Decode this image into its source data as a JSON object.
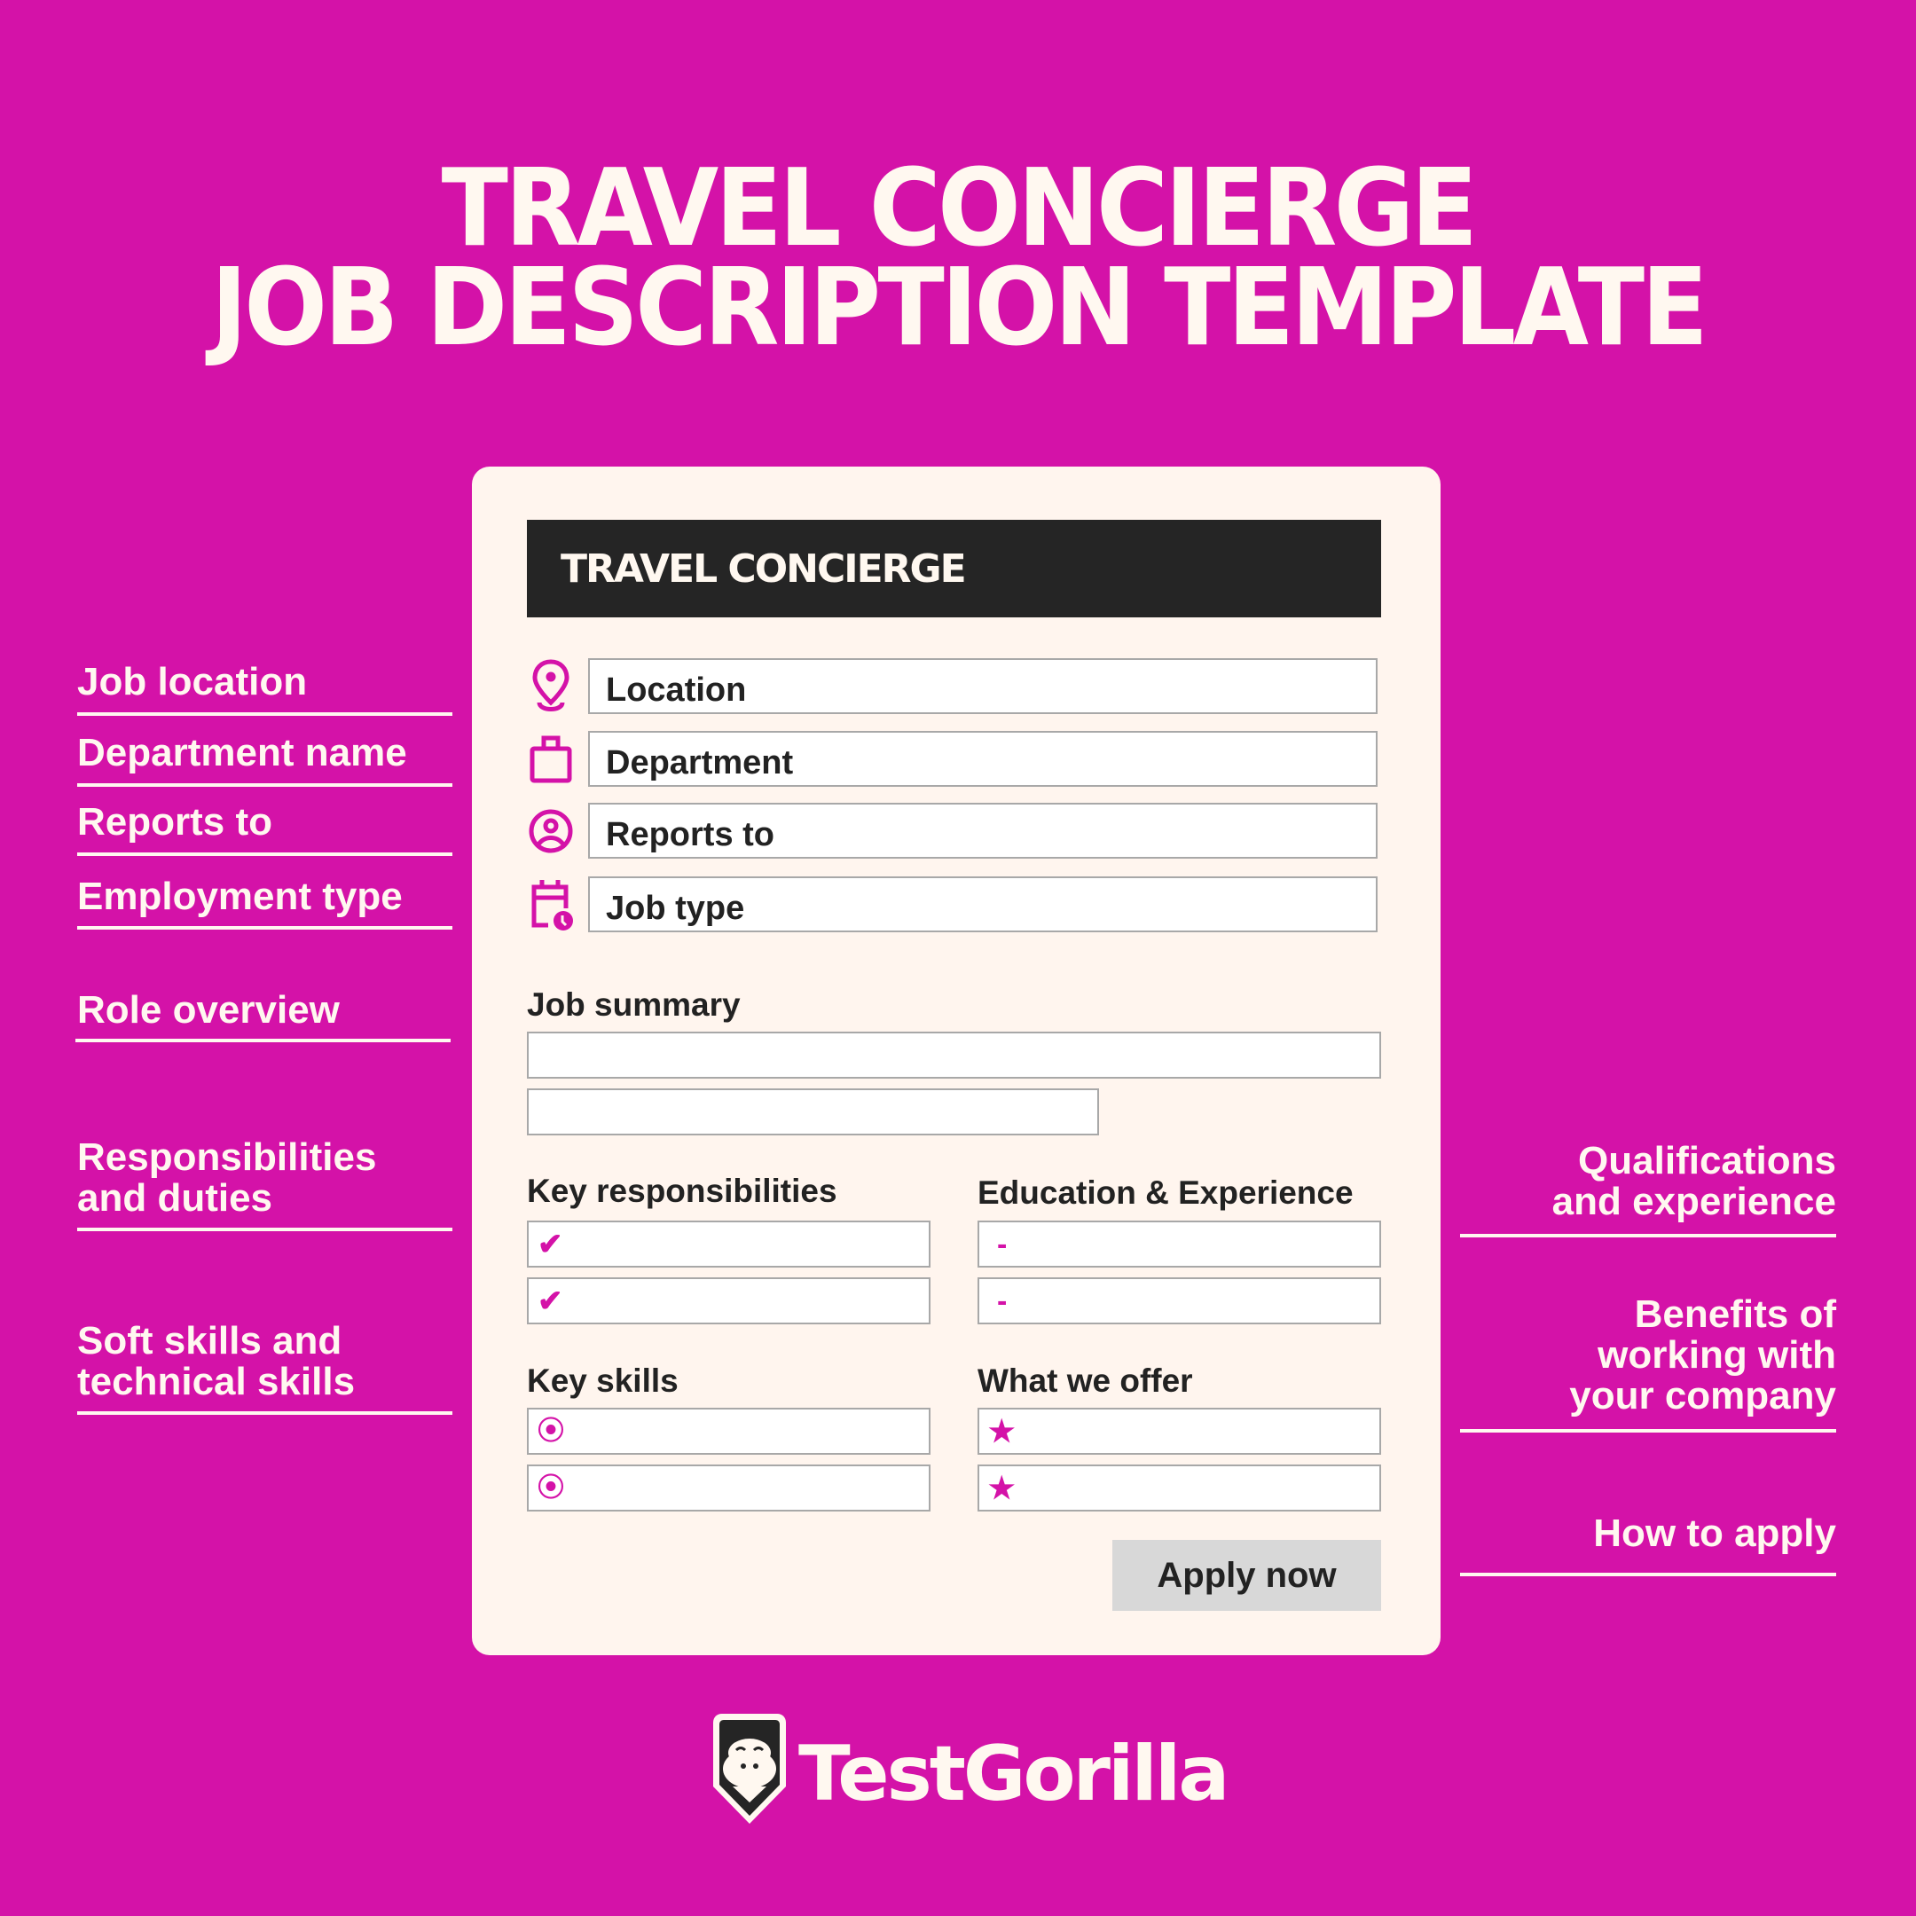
{
  "title": {
    "line1": "TRAVEL CONCIERGE",
    "line2": "JOB DESCRIPTION TEMPLATE"
  },
  "left_labels": [
    {
      "text": "Job location"
    },
    {
      "text": "Department name"
    },
    {
      "text": "Reports to"
    },
    {
      "text": "Employment type"
    },
    {
      "text": "Role overview"
    },
    {
      "text": "Responsibilities and duties"
    },
    {
      "text": "Soft skills and technical skills"
    }
  ],
  "right_labels": [
    {
      "text": "Qualifications and experience"
    },
    {
      "text": "Benefits of working with your company"
    },
    {
      "text": "How to apply"
    }
  ],
  "card": {
    "header": "TRAVEL CONCIERGE",
    "fields": [
      {
        "icon": "location-pin-icon",
        "label": "Location"
      },
      {
        "icon": "briefcase-icon",
        "label": "Department"
      },
      {
        "icon": "user-circle-icon",
        "label": "Reports to"
      },
      {
        "icon": "calendar-clock-icon",
        "label": "Job type"
      }
    ],
    "job_summary_label": "Job summary",
    "key_responsibilities_label": "Key responsibilities",
    "education_label": "Education & Experience",
    "key_skills_label": "Key skills",
    "what_we_offer_label": "What we offer",
    "bullets": {
      "responsibilities": "✔",
      "education": "-",
      "skills": "⦿",
      "offer": "★"
    },
    "apply_button": "Apply now"
  },
  "logo": {
    "text": "TestGorilla"
  },
  "colors": {
    "background": "#d412a8",
    "card": "#fff5ee",
    "header_bar": "#252525",
    "accent": "#d412a8",
    "text_dark": "#222222",
    "button": "#d8d8d8"
  }
}
